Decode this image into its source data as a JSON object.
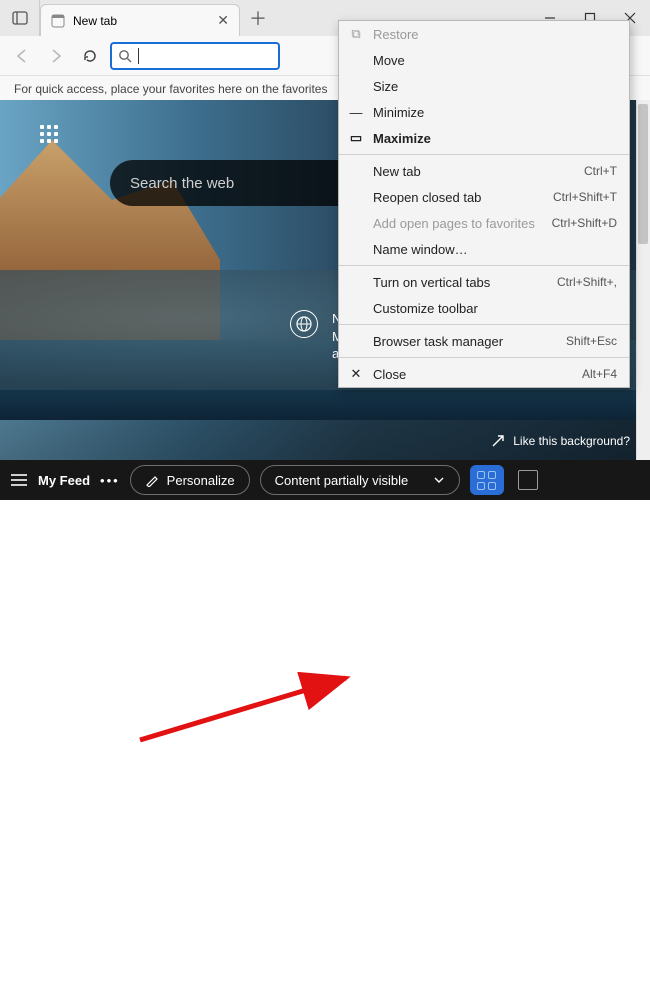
{
  "tab": {
    "title": "New tab"
  },
  "favorites_hint": "For quick access, place your favorites here on the favorites",
  "ntp": {
    "search_placeholder": "Search the web",
    "promo": "New from Surface—laptops designed by Microsoft. The perfect balance of performance and long battery life.",
    "like_bg": "Like this background?"
  },
  "feed": {
    "label": "My Feed",
    "personalize": "Personalize",
    "layout_select": "Content partially visible"
  },
  "context_menu": {
    "restore": "Restore",
    "move": "Move",
    "size": "Size",
    "minimize": "Minimize",
    "maximize": "Maximize",
    "new_tab": {
      "label": "New tab",
      "shortcut": "Ctrl+T"
    },
    "reopen_closed_tab": {
      "label": "Reopen closed tab",
      "shortcut": "Ctrl+Shift+T"
    },
    "add_pages_fav": {
      "label": "Add open pages to favorites",
      "shortcut": "Ctrl+Shift+D"
    },
    "name_window": "Name window…",
    "vertical_tabs": {
      "label": "Turn on vertical tabs",
      "shortcut": "Ctrl+Shift+,"
    },
    "customize_toolbar": "Customize toolbar",
    "task_manager": {
      "label": "Browser task manager",
      "shortcut": "Shift+Esc"
    },
    "close": {
      "label": "Close",
      "shortcut": "Alt+F4"
    }
  }
}
